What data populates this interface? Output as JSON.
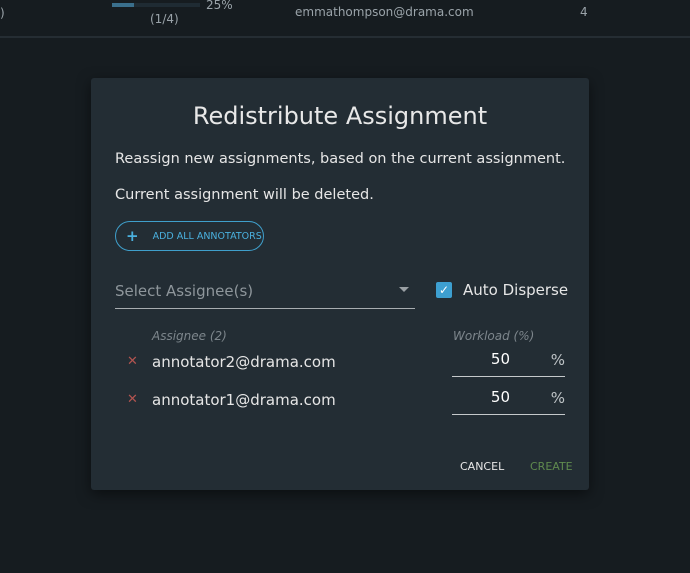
{
  "background_row": {
    "left_fragment": ")",
    "progress_percent": 25,
    "progress_label": "25%",
    "progress_count": "(1/4)",
    "email": "emmathompson@drama.com",
    "count": "4"
  },
  "dialog": {
    "title": "Redistribute Assignment",
    "line1": "Reassign new assignments, based on the current assignment.",
    "line2": "Current assignment will be deleted.",
    "add_all_label": "ADD ALL ANNOTATORS",
    "select_placeholder": "Select Assignee(s)",
    "auto_disperse_label": "Auto Disperse",
    "auto_disperse_checked": true,
    "assignee_header": "Assignee (2)",
    "workload_header": "Workload (%)",
    "assignees": [
      {
        "email": "annotator2@drama.com",
        "workload": "50"
      },
      {
        "email": "annotator1@drama.com",
        "workload": "50"
      }
    ],
    "percent_sign": "%",
    "cancel_label": "CANCEL",
    "create_label": "CREATE"
  },
  "colors": {
    "accent": "#3d9fd0",
    "create_disabled": "#5f8a4e",
    "remove": "#b25450"
  }
}
